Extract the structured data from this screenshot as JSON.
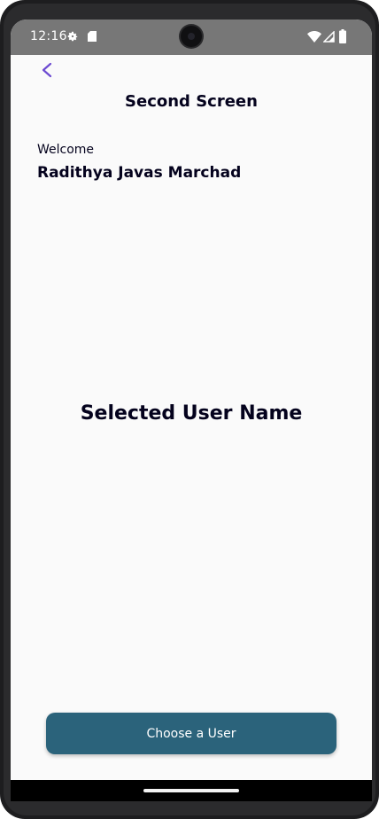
{
  "status_bar": {
    "time": "12:16",
    "icons": [
      "gear-icon",
      "sd-card-icon",
      "wifi-icon",
      "signal-icon",
      "battery-icon"
    ]
  },
  "app_bar": {
    "title": "Second Screen",
    "back_icon": "chevron-left-icon"
  },
  "greeting": {
    "label": "Welcome",
    "name": "Radithya Javas Marchad"
  },
  "selected_user": {
    "text": "Selected User Name"
  },
  "actions": {
    "choose_user_label": "Choose a User"
  },
  "colors": {
    "accent": "#6c4ad1",
    "primary_button": "#2b637b",
    "text_dark": "#04021d",
    "status_bar": "#777777",
    "background": "#fafafa"
  }
}
